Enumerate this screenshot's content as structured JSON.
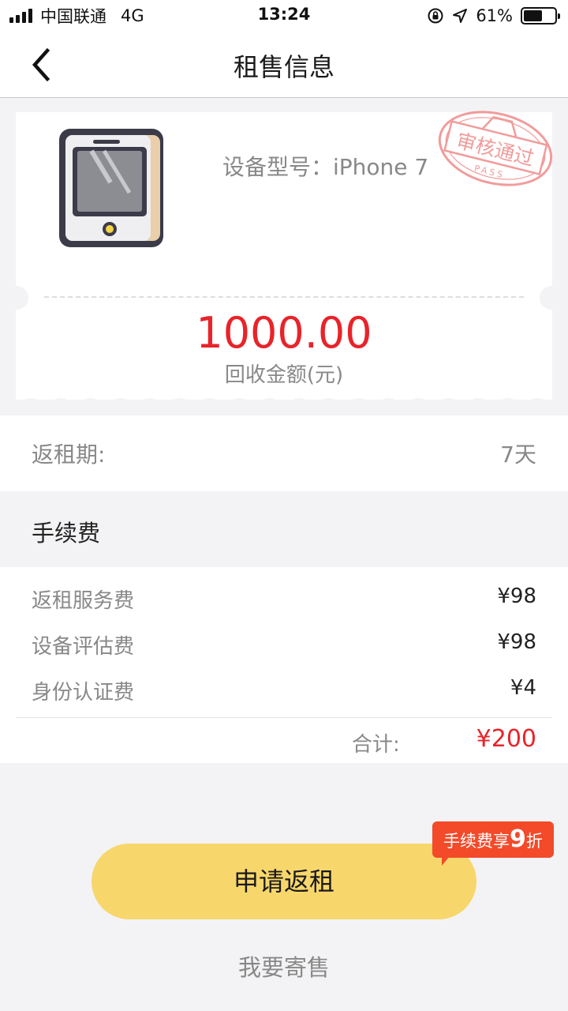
{
  "status_bar": {
    "carrier": "中国联通",
    "network": "4G",
    "time": "13:24",
    "battery_percent_text": "61%",
    "battery_level": 0.61
  },
  "nav": {
    "title": "租售信息",
    "back_icon": "chevron-left-icon"
  },
  "device": {
    "model_label": "设备型号：",
    "model_value": "iPhone 7",
    "icon": "tablet-phone-icon",
    "stamp_text": "审核通过",
    "stamp_subtext": "PASS",
    "stamp_color": "#f08a8a"
  },
  "recycle": {
    "amount": "1000.00",
    "amount_label": "回收金额(元)"
  },
  "rental_period": {
    "label": "返租期:",
    "value": "7天"
  },
  "fees": {
    "section_title": "手续费",
    "items": [
      {
        "label": "返租服务费",
        "value": "¥98"
      },
      {
        "label": "设备评估费",
        "value": "¥98"
      },
      {
        "label": "身份认证费",
        "value": "¥4"
      }
    ],
    "total_label": "合计:",
    "total_value": "¥200"
  },
  "actions": {
    "apply_label": "申请返租",
    "discount_prefix": "手续费享",
    "discount_number": "9",
    "discount_suffix": "折",
    "consign_label": "我要寄售"
  },
  "colors": {
    "accent_red": "#e8232a",
    "button_yellow": "#f7d76c",
    "badge_orange": "#f34a2a"
  }
}
